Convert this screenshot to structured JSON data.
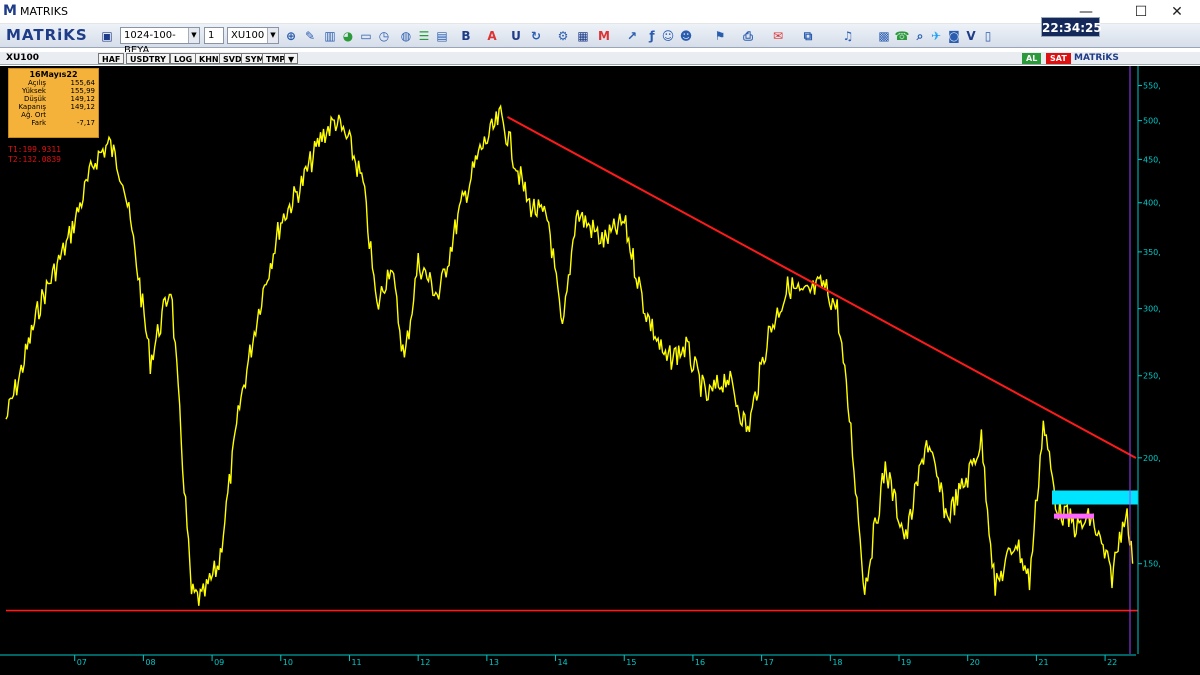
{
  "window": {
    "title": "MATRIKS",
    "clock": "22:34:25"
  },
  "toolbar": {
    "logo": "MATRiKS",
    "template_combo": "1024-100-BEYA",
    "layout_combo": "1",
    "symbol_combo": "XU100"
  },
  "chartbar": {
    "symbol": "XU100",
    "buttons": [
      "HAF",
      "USDTRY",
      "LOG",
      "KHN",
      "SVD",
      "SYM",
      "TMP"
    ],
    "buy_label": "AL",
    "sell_label": "SAT",
    "brand": "MATRiKS"
  },
  "infobox": {
    "date": "16Mayıs22",
    "rows": [
      {
        "label": "Açılış",
        "value": "155,64"
      },
      {
        "label": "Yüksek",
        "value": "155,99"
      },
      {
        "label": "Düşük",
        "value": "149,12"
      },
      {
        "label": "Kapanış",
        "value": "149,12"
      },
      {
        "label": "Ağ. Ort",
        "value": ""
      },
      {
        "label": "Fark",
        "value": "-7,17"
      }
    ],
    "t1": "T1:199.9311",
    "t2": "T2:132.0839"
  },
  "colors": {
    "price": "#ffff00",
    "trendline": "#ff1a1a",
    "support": "#ff1a1a",
    "highlight": "#00e5ff",
    "axis_text": "#00c8c8"
  },
  "chart_data": {
    "type": "line",
    "scale": "log",
    "x_ticks": [
      "07",
      "08",
      "09",
      "10",
      "11",
      "12",
      "13",
      "14",
      "15",
      "16",
      "17",
      "18",
      "19",
      "20",
      "21",
      "22"
    ],
    "y_ticks": [
      "550,",
      "500,",
      "450,",
      "400,",
      "350,",
      "300,",
      "250,",
      "200,",
      "150,"
    ],
    "series": [
      {
        "x": [
          2006.0,
          2006.2,
          2006.5,
          2006.9,
          2007.3,
          2007.5,
          2007.7,
          2007.9,
          2008.1,
          2008.4,
          2008.7,
          2008.85,
          2009.1,
          2009.4,
          2009.7,
          2010.0,
          2010.3,
          2010.6,
          2010.8,
          2011.0,
          2011.2,
          2011.4,
          2011.6,
          2011.8,
          2012.0,
          2012.3,
          2012.6,
          2012.9,
          2013.2,
          2013.3,
          2013.6,
          2013.9,
          2014.1,
          2014.3,
          2014.7,
          2015.0,
          2015.3,
          2015.6,
          2015.9,
          2016.2,
          2016.5,
          2016.8,
          2017.1,
          2017.4,
          2017.6,
          2017.9,
          2018.1,
          2018.3,
          2018.5,
          2018.8,
          2019.1,
          2019.4,
          2019.7,
          2020.0,
          2020.2,
          2020.4,
          2020.7,
          2020.9,
          2021.1,
          2021.3,
          2021.6,
          2021.8,
          2022.1,
          2022.3,
          2022.4
        ],
        "values": [
          222,
          250,
          305,
          360,
          450,
          470,
          430,
          340,
          260,
          320,
          138,
          136,
          150,
          230,
          305,
          380,
          420,
          480,
          500,
          470,
          420,
          300,
          340,
          260,
          340,
          310,
          390,
          460,
          505,
          480,
          400,
          380,
          280,
          390,
          360,
          380,
          300,
          260,
          270,
          235,
          250,
          215,
          280,
          320,
          310,
          320,
          300,
          215,
          140,
          195,
          160,
          210,
          170,
          190,
          210,
          140,
          160,
          143,
          220,
          175,
          165,
          170,
          145,
          175,
          150
        ]
      }
    ],
    "trendline": {
      "from": {
        "x": 2013.3,
        "y": 505
      },
      "to": {
        "x": 2022.45,
        "y": 199.93
      }
    },
    "support": {
      "y": 132.08
    }
  }
}
